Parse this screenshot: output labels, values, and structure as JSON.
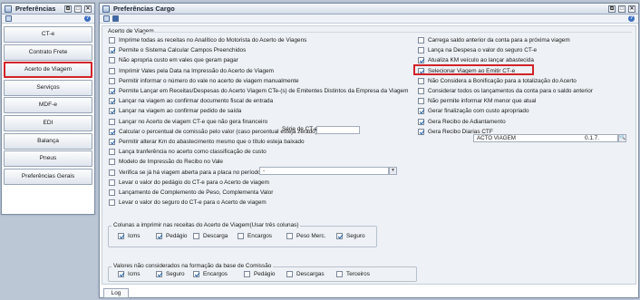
{
  "left_window": {
    "title": "Preferências",
    "nav": [
      "CT-e",
      "Contrato Frete",
      "Acerto de Viagem",
      "Serviços",
      "MDF-e",
      "EDI",
      "Balança",
      "Pneus",
      "Preferências Gerais"
    ],
    "selected": 2
  },
  "right_window": {
    "title": "Preferências Cargo"
  },
  "section": "Acerto de Viagem",
  "left_options": [
    {
      "label": "Imprime todas as receitas no Analítico do Motorista do Acerto de Viagens",
      "checked": false
    },
    {
      "label": "Permite o Sistema Calcular Campos Preenchidos",
      "checked": true
    },
    {
      "label": "Não apropria custo em vales que geram pagar",
      "checked": false
    },
    {
      "label": "Imprimir Vales pela Data   na Impressão do Acerto  de Viagem",
      "checked": false
    },
    {
      "label": "Permitir informar o número do vale no acerto de viagem manualmente",
      "checked": false
    },
    {
      "label": "Permite Lançar em Receitas/Despesas do Acerto Viagem CTe-(s) de  Emitentes Distintos da Empresa da Viagem",
      "checked": true
    },
    {
      "label": "Lançar na viagem ao confirmar documento fiscal de entrada",
      "checked": true
    },
    {
      "label": "Lançar na viagem ao confirmar pedido de saída",
      "checked": true
    },
    {
      "label": "Lançar no Acerto de viagem CT-e que não gera financeiro",
      "checked": false
    },
    {
      "label": "Calcular o percentual de comissão pelo valor (caso percentual esteja zerado)",
      "checked": true
    },
    {
      "label": "Permitir alterar Km do abastecimento mesmo que o título esteja baixado",
      "checked": true
    },
    {
      "label": "Lança tranferência no acerto como classificação de custo",
      "checked": false
    },
    {
      "label": "Modelo de  Impressão do Recibo no Vale",
      "checked": false
    },
    {
      "label": "Verifica se já há viagem aberta para a placa no período",
      "checked": false
    },
    {
      "label": "Levar o valor do pedágio do CT-e para o Acerto de viagem",
      "checked": false
    },
    {
      "label": "Lançamento de Complemento de Peso, Complementa Valor",
      "checked": false
    },
    {
      "label": "Levar o valor do seguro do CT-e para o Acerto de viagem",
      "checked": false
    }
  ],
  "serie_cte_label": "Série de CT-e",
  "dropdown_glyph": "▾",
  "modelo_recibo_value": "-",
  "right_options": [
    {
      "label": "Carrega saldo anterior da conta para a próxima viagem",
      "checked": false
    },
    {
      "label": "Lança na Despesa o valor do seguro CT-e",
      "checked": false
    },
    {
      "label": "Atualiza KM veículo ao lançar abastecida",
      "checked": true
    },
    {
      "label": "Selecionar Viagem ao Emitir CT-e",
      "checked": true
    },
    {
      "label": "Não Considera a Bonificação para a totalização do Acerto",
      "checked": false
    },
    {
      "label": "Considerar todos os lançamentos da conta para o saldo anterior",
      "checked": false
    },
    {
      "label": "Não permite informar KM menor que atual",
      "checked": false
    },
    {
      "label": "Gerar finalização com custo apropriado",
      "checked": true
    },
    {
      "label": "Gera Recibo de Adiantamento",
      "checked": true
    },
    {
      "label": "Gera Recibo Diarias CTF",
      "checked": true
    }
  ],
  "recibo_field": "ACTO VIAGEM",
  "recibo_code": "0.1.7.",
  "group1": {
    "label": "Colunas a imprimir nas receitas do Acerto de Viagem(Usar  três colunas)",
    "items": [
      {
        "label": "Icms",
        "checked": true
      },
      {
        "label": "Pedágio",
        "checked": true
      },
      {
        "label": "Descarga",
        "checked": false
      },
      {
        "label": "Encargos",
        "checked": false
      },
      {
        "label": "Peso Merc.",
        "checked": false
      },
      {
        "label": "Seguro",
        "checked": true
      }
    ]
  },
  "group2": {
    "label": "Valores não considerados na formação da base de Comissão",
    "items": [
      {
        "label": "Icms",
        "checked": true
      },
      {
        "label": "Seguro",
        "checked": true
      },
      {
        "label": "Encargos",
        "checked": true
      },
      {
        "label": "Pedágio",
        "checked": false
      },
      {
        "label": "Descargas",
        "checked": false
      },
      {
        "label": "Terceiros",
        "checked": false
      }
    ]
  },
  "log_tab": "Log",
  "window_buttons": [
    "⧉",
    "□",
    "✕"
  ],
  "help_glyph": "?",
  "search_glyph": "🔍",
  "highlight_color": "#d2232a"
}
